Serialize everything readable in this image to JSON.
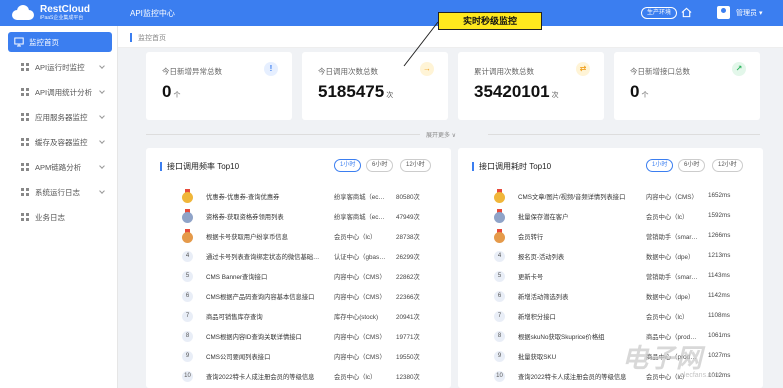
{
  "header": {
    "logo_name": "RestCloud",
    "logo_sub": "iPaaS企业集成平台",
    "app_title": "API监控中心",
    "env_badge": "生产环境",
    "user_name": "管理员 ▾"
  },
  "sidebar": {
    "items": [
      {
        "label": "监控首页"
      },
      {
        "label": "API运行时监控"
      },
      {
        "label": "API调用统计分析"
      },
      {
        "label": "应用服务器监控"
      },
      {
        "label": "缓存及容器监控"
      },
      {
        "label": "APM链路分析"
      },
      {
        "label": "系统运行日志"
      },
      {
        "label": "业务日志"
      }
    ]
  },
  "breadcrumb": "监控首页",
  "annotation": "实时秒级监控",
  "stats": [
    {
      "label": "今日新增异常总数",
      "value": "0",
      "unit": "个",
      "icon": "!"
    },
    {
      "label": "今日调用次数总数",
      "value": "5185475",
      "unit": "次",
      "icon": "→"
    },
    {
      "label": "累计调用次数总数",
      "value": "35420101",
      "unit": "次",
      "icon": "⇄"
    },
    {
      "label": "今日新增接口总数",
      "value": "0",
      "unit": "个",
      "icon": "↗"
    }
  ],
  "expand_label": "展开更多 ∨",
  "left_panel": {
    "title": "接口调用频率 Top10",
    "filters": [
      "1小时",
      "6小时",
      "12小时"
    ],
    "rows": [
      {
        "rank": "1",
        "name": "优惠券-优惠券-查询优惠券",
        "group": "纷享客商城（ec…",
        "value": "80580次"
      },
      {
        "rank": "2",
        "name": "资格券-获取资格券领用列表",
        "group": "纷享客商城（ec…",
        "value": "47949次"
      },
      {
        "rank": "3",
        "name": "根据卡号获取用户纷享币信息",
        "group": "会员中心（lc）",
        "value": "28738次"
      },
      {
        "rank": "4",
        "name": "通过卡号列表查询绑定状态的微信基础…",
        "group": "认证中心（gbas…",
        "value": "26299次"
      },
      {
        "rank": "5",
        "name": "CMS Banner查询接口",
        "group": "内容中心（CMS）",
        "value": "22862次"
      },
      {
        "rank": "6",
        "name": "CMS根据产品码查询内容基本信息接口",
        "group": "内容中心（CMS）",
        "value": "22366次"
      },
      {
        "rank": "7",
        "name": "商品可销售库存查询",
        "group": "库存中心(stock)",
        "value": "20941次"
      },
      {
        "rank": "8",
        "name": "CMS根据内容ID查询关联详情接口",
        "group": "内容中心（CMS）",
        "value": "19771次"
      },
      {
        "rank": "9",
        "name": "CMS公司要闻列表接口",
        "group": "内容中心（CMS）",
        "value": "19550次"
      },
      {
        "rank": "10",
        "name": "查询2022特卡人成注册会员的等级信息",
        "group": "会员中心（lc）",
        "value": "12380次"
      }
    ]
  },
  "right_panel": {
    "title": "接口调用耗时 Top10",
    "filters": [
      "1小时",
      "6小时",
      "12小时"
    ],
    "rows": [
      {
        "rank": "1",
        "name": "CMS文章/图片/视频/音频详情列表接口",
        "group": "内容中心（CMS）",
        "value": "1652ms"
      },
      {
        "rank": "2",
        "name": "批量保存潜在客户",
        "group": "会员中心（lc）",
        "value": "1592ms"
      },
      {
        "rank": "3",
        "name": "会员转行",
        "group": "营销助手（smar…",
        "value": "1266ms"
      },
      {
        "rank": "4",
        "name": "报名页-活动列表",
        "group": "数据中心（dpe）",
        "value": "1213ms"
      },
      {
        "rank": "5",
        "name": "更新卡号",
        "group": "营销助手（smar…",
        "value": "1143ms"
      },
      {
        "rank": "6",
        "name": "新增活动筛选列表",
        "group": "数据中心（dpe）",
        "value": "1142ms"
      },
      {
        "rank": "7",
        "name": "新增积分接口",
        "group": "会员中心（lc）",
        "value": "1108ms"
      },
      {
        "rank": "8",
        "name": "根据skuNo获取Skuprice价格组",
        "group": "商品中心（prod…",
        "value": "1061ms"
      },
      {
        "rank": "9",
        "name": "批量获取SKU",
        "group": "商品中心（prod…",
        "value": "1027ms"
      },
      {
        "rank": "10",
        "name": "查询2022特卡人成注册会员的等级信息",
        "group": "会员中心（lc）",
        "value": "1012ms"
      }
    ]
  },
  "watermark": "电子网",
  "watermark_sub": "elecfans.com",
  "colors": {
    "primary": "#3b7ef0",
    "gold": "#f0b63a",
    "silver": "#8fa3c8",
    "bronze": "#e59a4a"
  }
}
